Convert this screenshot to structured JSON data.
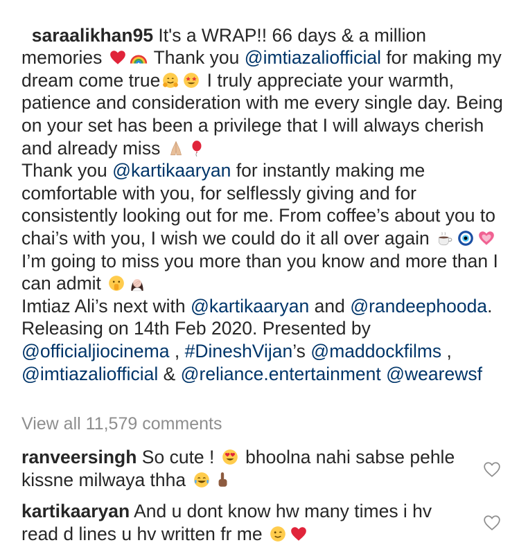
{
  "post": {
    "username": "saraalikhan95",
    "caption_parts": [
      {
        "t": "plain",
        "v": " It's a WRAP!! 66 days & a million memories "
      },
      {
        "t": "emoji",
        "v": "red-heart-emoji"
      },
      {
        "t": "emoji",
        "v": "rainbow-emoji"
      },
      {
        "t": "plain",
        "v": " Thank you "
      },
      {
        "t": "mention",
        "v": "@imtiazaliofficial"
      },
      {
        "t": "plain",
        "v": " for making my dream come true"
      },
      {
        "t": "emoji",
        "v": "hugging-face-emoji"
      },
      {
        "t": "emoji",
        "v": "star-struck-emoji"
      },
      {
        "t": "plain",
        "v": " I truly appreciate your warmth, patience and consideration with me every single day. Being on your set has been a privilege that I will always cherish and already miss "
      },
      {
        "t": "emoji",
        "v": "folded-hands-emoji"
      },
      {
        "t": "emoji",
        "v": "balloon-emoji"
      },
      {
        "t": "plain",
        "v": "\nThank you "
      },
      {
        "t": "mention",
        "v": "@kartikaaryan"
      },
      {
        "t": "plain",
        "v": " for instantly making me comfortable with you, for selflessly giving and for consistently looking out for me. From coffee’s about you to chai’s with you, I wish we could do it all over again "
      },
      {
        "t": "emoji",
        "v": "hot-beverage-emoji"
      },
      {
        "t": "emoji",
        "v": "nazar-amulet-emoji"
      },
      {
        "t": "emoji",
        "v": "growing-heart-emoji"
      },
      {
        "t": "plain",
        "v": " I’m going to miss you more than you know and more than I can admit "
      },
      {
        "t": "emoji",
        "v": "shushing-face-emoji"
      },
      {
        "t": "emoji",
        "v": "woman-facepalming-emoji"
      },
      {
        "t": "plain",
        "v": "\nImtiaz Ali’s next with "
      },
      {
        "t": "mention",
        "v": "@kartikaaryan"
      },
      {
        "t": "plain",
        "v": " and "
      },
      {
        "t": "mention",
        "v": "@randeephooda"
      },
      {
        "t": "plain",
        "v": ".  Releasing on 14th Feb 2020. Presented by "
      },
      {
        "t": "mention",
        "v": "@officialjiocinema"
      },
      {
        "t": "plain",
        "v": " , "
      },
      {
        "t": "hashtag",
        "v": "#DineshVijan"
      },
      {
        "t": "plain",
        "v": "’s "
      },
      {
        "t": "mention",
        "v": "@maddockfilms"
      },
      {
        "t": "plain",
        "v": " , "
      },
      {
        "t": "mention",
        "v": "@imtiazaliofficial"
      },
      {
        "t": "plain",
        "v": " & "
      },
      {
        "t": "mention",
        "v": "@reliance.entertainment"
      },
      {
        "t": "plain",
        "v": " "
      },
      {
        "t": "mention",
        "v": "@wearewsf"
      }
    ]
  },
  "view_all_comments": "View all 11,579 comments",
  "comments": [
    {
      "username": "ranveersingh",
      "parts": [
        {
          "t": "plain",
          "v": " So cute ! "
        },
        {
          "t": "emoji",
          "v": "heart-eyes-emoji"
        },
        {
          "t": "plain",
          "v": " bhoolna nahi sabse pehle kissne milwaya thha "
        },
        {
          "t": "emoji",
          "v": "tears-of-joy-emoji"
        },
        {
          "t": "emoji",
          "v": "index-pointing-up-emoji"
        }
      ]
    },
    {
      "username": "kartikaaryan",
      "parts": [
        {
          "t": "plain",
          "v": " And u dont know hw many times i hv read d lines u hv written fr me "
        },
        {
          "t": "emoji",
          "v": "winking-face-emoji"
        },
        {
          "t": "emoji",
          "v": "red-heart-emoji"
        }
      ]
    }
  ],
  "colors": {
    "text": "#262626",
    "link": "#003569",
    "muted": "#8e8e8e"
  }
}
